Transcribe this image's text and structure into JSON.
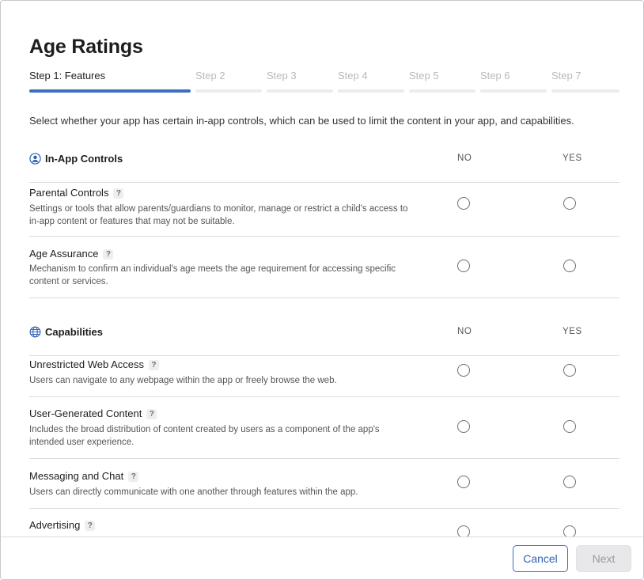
{
  "dialog": {
    "title": "Age Ratings"
  },
  "steps": [
    {
      "label": "Step 1: Features",
      "active": true
    },
    {
      "label": "Step 2",
      "active": false
    },
    {
      "label": "Step 3",
      "active": false
    },
    {
      "label": "Step 4",
      "active": false
    },
    {
      "label": "Step 5",
      "active": false
    },
    {
      "label": "Step 6",
      "active": false
    },
    {
      "label": "Step 7",
      "active": false
    }
  ],
  "intro": "Select whether your app has certain in-app controls, which can be used to limit the content in your app, and capabilities.",
  "sections": [
    {
      "title": "In-App Controls",
      "icon": "person-circle-icon",
      "col_no": "NO",
      "col_yes": "YES",
      "items": [
        {
          "name": "Parental Controls",
          "help": "?",
          "desc": "Settings or tools that allow parents/guardians to monitor, manage or restrict a child's access to in-app content or features that may not be suitable."
        },
        {
          "name": "Age Assurance",
          "help": "?",
          "desc": "Mechanism to confirm an individual's age meets the age requirement for accessing specific content or services."
        }
      ]
    },
    {
      "title": "Capabilities",
      "icon": "globe-icon",
      "col_no": "NO",
      "col_yes": "YES",
      "items": [
        {
          "name": "Unrestricted Web Access",
          "help": "?",
          "desc": "Users can navigate to any webpage within the app or freely browse the web."
        },
        {
          "name": "User-Generated Content",
          "help": "?",
          "desc": "Includes the broad distribution of content created by users as a component of the app's intended user experience."
        },
        {
          "name": "Messaging and Chat",
          "help": "?",
          "desc": "Users can directly communicate with one another through features within the app."
        },
        {
          "name": "Advertising",
          "help": "?",
          "desc": ""
        }
      ]
    }
  ],
  "footer": {
    "cancel_label": "Cancel",
    "next_label": "Next"
  },
  "colors": {
    "accent": "#3b6fbf",
    "step_inactive": "#ececee"
  }
}
